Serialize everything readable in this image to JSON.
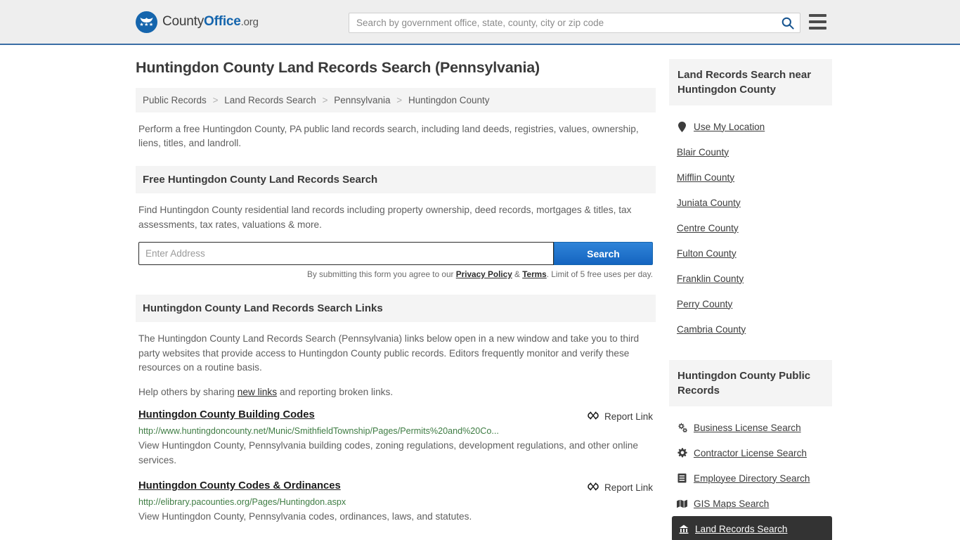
{
  "header": {
    "logo": {
      "text_county": "County",
      "text_office": "Office",
      "text_org": ".org",
      "stars": "★★★"
    },
    "search": {
      "placeholder": "Search by government office, state, county, city or zip code",
      "value": "",
      "icon": "search-icon"
    },
    "menu_icon": "hamburger-menu-icon"
  },
  "main": {
    "title": "Huntingdon County Land Records Search (Pennsylvania)",
    "breadcrumb": [
      "Public Records",
      "Land Records Search",
      "Pennsylvania",
      "Huntingdon County"
    ],
    "breadcrumb_separator": ">",
    "intro": "Perform a free Huntingdon County, PA public land records search, including land deeds, registries, values, ownership, liens, titles, and landroll.",
    "free_search": {
      "heading": "Free Huntingdon County Land Records Search",
      "description": "Find Huntingdon County residential land records including property ownership, deed records, mortgages & titles, tax assessments, tax rates, valuations & more.",
      "input_placeholder": "Enter Address",
      "input_value": "",
      "button_label": "Search",
      "fineprint_pre": "By submitting this form you agree to our ",
      "fineprint_privacy": "Privacy Policy",
      "fineprint_amp": " & ",
      "fineprint_terms": "Terms",
      "fineprint_post": ". Limit of 5 free uses per day."
    },
    "links_section": {
      "heading": "Huntingdon County Land Records Search Links",
      "paragraph": "The Huntingdon County Land Records Search (Pennsylvania) links below open in a new window and take you to third party websites that provide access to Huntingdon County public records. Editors frequently monitor and verify these resources on a routine basis.",
      "help_pre": "Help others by sharing ",
      "help_link": "new links",
      "help_post": " and reporting broken links.",
      "report_label": "Report Link",
      "report_icon": "broken-link-icon"
    },
    "results": [
      {
        "title": "Huntingdon County Building Codes",
        "url": "http://www.huntingdoncounty.net/Munic/SmithfieldTownship/Pages/Permits%20and%20Co...",
        "description": "View Huntingdon County, Pennsylvania building codes, zoning regulations, development regulations, and other online services."
      },
      {
        "title": "Huntingdon County Codes & Ordinances",
        "url": "http://elibrary.pacounties.org/Pages/Huntingdon.aspx",
        "description": "View Huntingdon County, Pennsylvania codes, ordinances, laws, and statutes."
      }
    ]
  },
  "sidebar": {
    "near_panel": {
      "heading": "Land Records Search near Huntingdon County",
      "items": [
        {
          "label": "Use My Location",
          "icon": "map-pin-icon"
        },
        {
          "label": "Blair County",
          "icon": ""
        },
        {
          "label": "Mifflin County",
          "icon": ""
        },
        {
          "label": "Juniata County",
          "icon": ""
        },
        {
          "label": "Centre County",
          "icon": ""
        },
        {
          "label": "Fulton County",
          "icon": ""
        },
        {
          "label": "Franklin County",
          "icon": ""
        },
        {
          "label": "Perry County",
          "icon": ""
        },
        {
          "label": "Cambria County",
          "icon": ""
        }
      ]
    },
    "public_records_panel": {
      "heading": "Huntingdon County Public Records",
      "items": [
        {
          "label": "Business License Search",
          "icon": "gears-icon",
          "active": false
        },
        {
          "label": "Contractor License Search",
          "icon": "gear-icon",
          "active": false
        },
        {
          "label": "Employee Directory Search",
          "icon": "book-icon",
          "active": false
        },
        {
          "label": "GIS Maps Search",
          "icon": "map-icon",
          "active": false
        },
        {
          "label": "Land Records Search",
          "icon": "landmark-icon",
          "active": true
        }
      ]
    }
  },
  "colors": {
    "brand_blue": "#1565ad",
    "header_bg": "#eeeeee",
    "panel_bg": "#f4f4f4",
    "url_green": "#3e7c43",
    "active_bg": "#333333"
  }
}
